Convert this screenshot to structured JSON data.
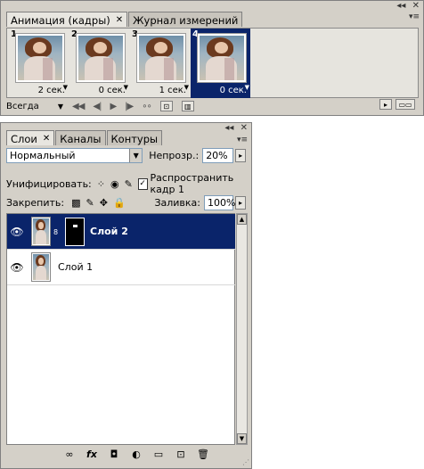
{
  "animation_panel": {
    "tabs": [
      {
        "label": "Анимация (кадры)",
        "close": "✕"
      },
      {
        "label": "Журнал измерений"
      }
    ],
    "frames": [
      {
        "number": "1",
        "duration": "2 сек.",
        "selected": false
      },
      {
        "number": "2",
        "duration": "0 сек.",
        "selected": false
      },
      {
        "number": "3",
        "duration": "1 сек.",
        "selected": false
      },
      {
        "number": "4",
        "duration": "0 сек.",
        "selected": true
      }
    ],
    "loop_value": "Всегда",
    "controls": [
      "first-frame-icon",
      "prev-frame-icon",
      "play-icon",
      "next-frame-icon",
      "tween-icon",
      "new-frame-icon",
      "delete-frame-icon"
    ]
  },
  "layers_panel": {
    "tabs": [
      {
        "label": "Слои",
        "close": "✕"
      },
      {
        "label": "Каналы"
      },
      {
        "label": "Контуры"
      }
    ],
    "blend_mode": "Нормальный",
    "opacity_label": "Непрозр.:",
    "opacity_value": "20%",
    "unify_label": "Унифицировать:",
    "propagate_label": "Распространить кадр 1",
    "propagate_checked": true,
    "lock_label": "Закрепить:",
    "fill_label": "Заливка:",
    "fill_value": "100%",
    "layers": [
      {
        "name": "Слой 2",
        "selected": true,
        "has_mask": true
      },
      {
        "name": "Слой 1",
        "selected": false,
        "has_mask": false
      }
    ],
    "bottom_tools": [
      "link-layers-icon",
      "fx-icon",
      "add-mask-icon",
      "adjustment-layer-icon",
      "new-group-icon",
      "new-layer-icon",
      "delete-layer-icon"
    ],
    "fx_label": "fx"
  },
  "colors": {
    "panel_bg": "#d4d0c8",
    "selection": "#0a246a"
  }
}
